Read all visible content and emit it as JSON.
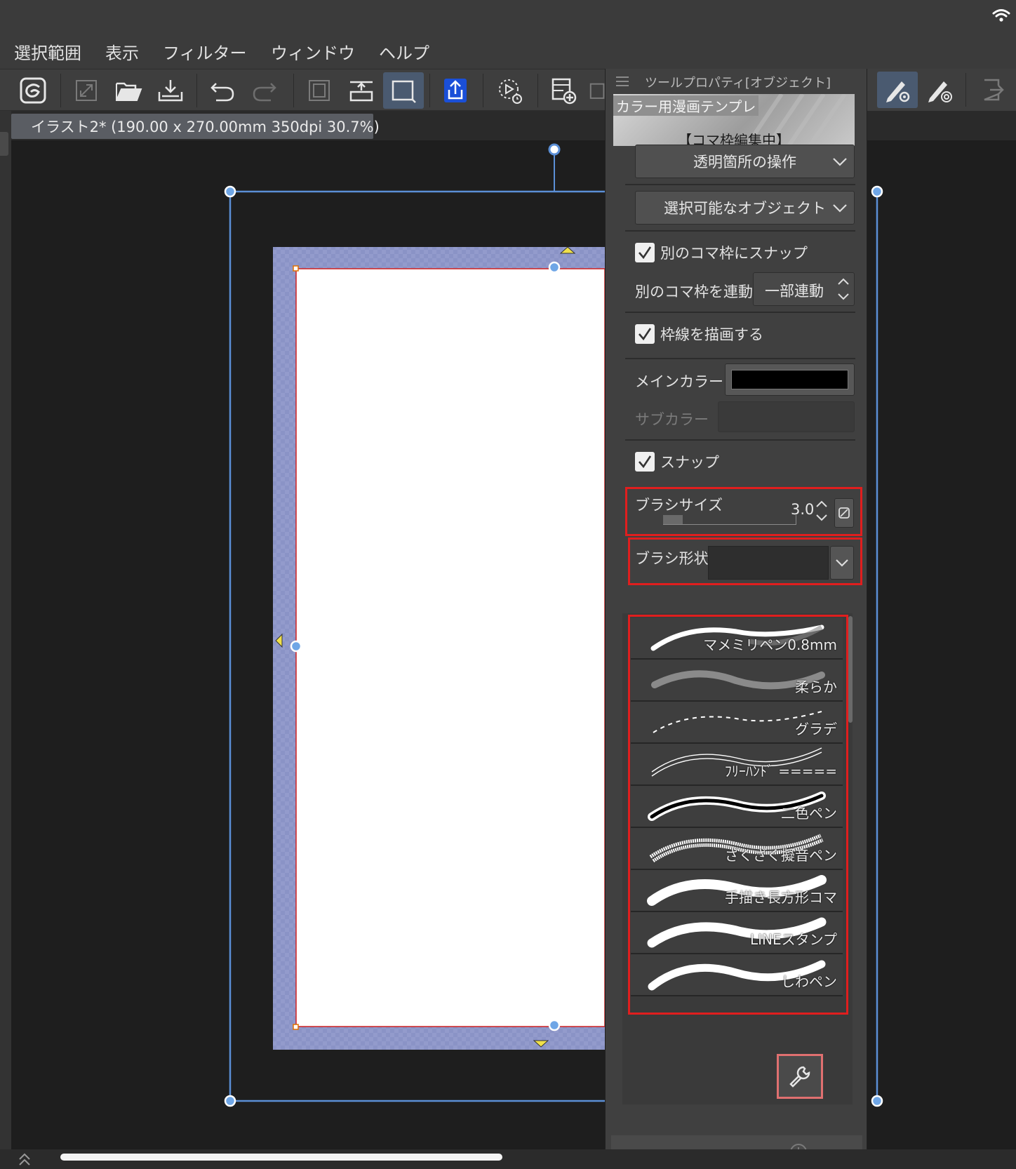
{
  "menu": {
    "items": [
      {
        "label": "選択範囲"
      },
      {
        "label": "表示"
      },
      {
        "label": "フィルター"
      },
      {
        "label": "ウィンドウ"
      },
      {
        "label": "ヘルプ"
      }
    ]
  },
  "tab": {
    "title": "イラスト2* (190.00 x 270.00mm 350dpi 30.7%)"
  },
  "panel": {
    "header_title": "ツールプロパティ[オブジェクト]",
    "preview_title": "カラー用漫画テンプレ",
    "preview_subtitle": "【コマ枠編集中】",
    "dropdown_transparent": "透明箇所の操作",
    "dropdown_selectable": "選択可能なオブジェクト",
    "snap_other_frames": "別のコマ枠にスナップ",
    "link_frames_label": "別のコマ枠を連動",
    "link_frames_value": "一部連動",
    "draw_border": "枠線を描画する",
    "main_color_label": "メインカラー",
    "sub_color_label": "サブカラー",
    "snap": "スナップ",
    "brush_size_label": "ブラシサイズ",
    "brush_size_value": "3.0",
    "brush_size_fraction": 0.15,
    "brush_shape_label": "ブラシ形状",
    "main_color": "#000000"
  },
  "brushes": [
    {
      "name": "マメミリペン0.8mm"
    },
    {
      "name": "柔らか"
    },
    {
      "name": "グラデ"
    },
    {
      "name": "ﾌﾘｰﾊﾝﾄﾞ ====="
    },
    {
      "name": "二色ペン"
    },
    {
      "name": "ざくざく擬音ペン"
    },
    {
      "name": "手描き長方形コマ"
    },
    {
      "name": "LINEスタンプ"
    },
    {
      "name": "しわペン"
    }
  ],
  "colors": {
    "accent_selected": "#4a5a70",
    "highlight_red": "#e01e1e",
    "frame_blue": "#5b8fd6",
    "bleed_area": "#8a93c6"
  }
}
